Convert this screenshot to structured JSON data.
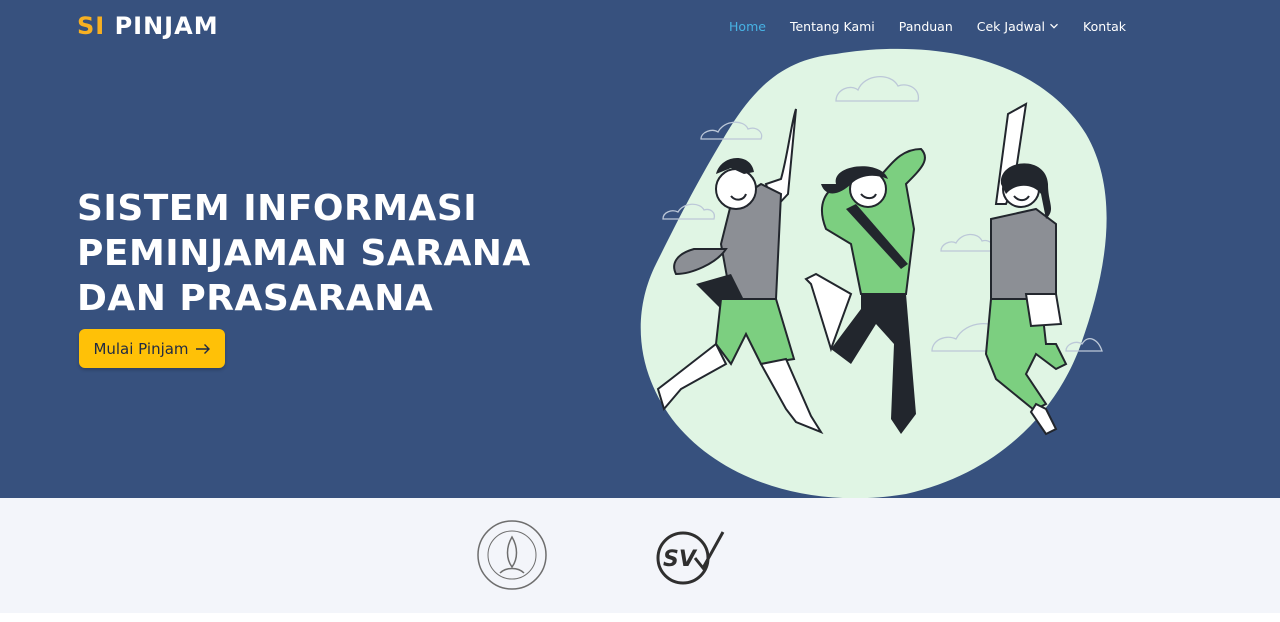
{
  "brand": {
    "prefix": "SI",
    "name": "PINJAM",
    "accent_color": "#f7b022"
  },
  "nav": {
    "items": [
      {
        "label": "Home",
        "active": true
      },
      {
        "label": "Tentang Kami"
      },
      {
        "label": "Panduan"
      },
      {
        "label": "Cek Jadwal",
        "dropdown_icon": "chevron-down-icon"
      },
      {
        "label": "Kontak"
      }
    ],
    "active_color": "#47b2e4"
  },
  "hero": {
    "title_lines": [
      "SISTEM INFORMASI",
      "PEMINJAMAN SARANA",
      "DAN PRASARANA"
    ],
    "cta": {
      "label": "Mulai Pinjam",
      "icon": "arrow-right-icon",
      "color": "#ffc107"
    },
    "background_color": "#37517e",
    "illustration": "three-jumping-students"
  },
  "partners": [
    {
      "name": "university-seal-logo"
    },
    {
      "name": "sv-logo",
      "text": "SV"
    }
  ]
}
